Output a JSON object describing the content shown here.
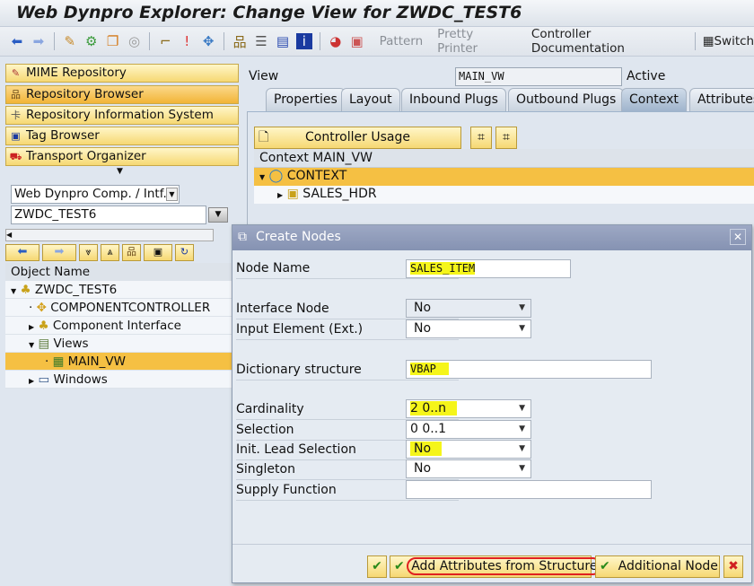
{
  "window": {
    "title": "Web Dynpro Explorer: Change View for ZWDC_TEST6"
  },
  "toolbar": {
    "pattern": "Pattern",
    "pretty_printer": "Pretty Printer",
    "controller_documentation": "Controller Documentation",
    "switch": "Switch"
  },
  "nav": {
    "items": [
      {
        "label": "MIME Repository",
        "icon": "mime-icon"
      },
      {
        "label": "Repository Browser",
        "icon": "hierarchy-icon"
      },
      {
        "label": "Repository Information System",
        "icon": "info-system-icon"
      },
      {
        "label": "Tag Browser",
        "icon": "tag-icon"
      },
      {
        "label": "Transport Organizer",
        "icon": "truck-icon"
      }
    ]
  },
  "object_selector": {
    "type": "Web Dynpro Comp. / Intf.",
    "name": "ZWDC_TEST6"
  },
  "tree": {
    "header": "Object Name",
    "rows": [
      {
        "label": "ZWDC_TEST6"
      },
      {
        "label": "COMPONENTCONTROLLER"
      },
      {
        "label": "Component Interface"
      },
      {
        "label": "Views"
      },
      {
        "label": "MAIN_VW"
      },
      {
        "label": "Windows"
      }
    ]
  },
  "view": {
    "label": "View",
    "name": "MAIN_VW",
    "status": "Active"
  },
  "tabs": [
    "Properties",
    "Layout",
    "Inbound Plugs",
    "Outbound Plugs",
    "Context",
    "Attributes"
  ],
  "context": {
    "controller_usage": "Controller Usage",
    "header": "Context MAIN_VW",
    "root": "CONTEXT",
    "child": "SALES_HDR"
  },
  "dialog": {
    "title": "Create Nodes",
    "fields": {
      "node_name": {
        "label": "Node Name",
        "value": "SALES_ITEM"
      },
      "interface_node": {
        "label": "Interface Node",
        "value": "No"
      },
      "input_element": {
        "label": "Input Element (Ext.)",
        "value": "No"
      },
      "dictionary_structure": {
        "label": "Dictionary structure",
        "value": "VBAP"
      },
      "cardinality": {
        "label": "Cardinality",
        "value": "2 0..n"
      },
      "selection": {
        "label": "Selection",
        "value": "0 0..1"
      },
      "init_lead_selection": {
        "label": "Init. Lead Selection",
        "value": "No"
      },
      "singleton": {
        "label": "Singleton",
        "value": "No"
      },
      "supply_function": {
        "label": "Supply Function",
        "value": ""
      }
    },
    "buttons": {
      "add_attributes": "Add Attributes from Structure",
      "additional_node": "Additional Node"
    }
  }
}
